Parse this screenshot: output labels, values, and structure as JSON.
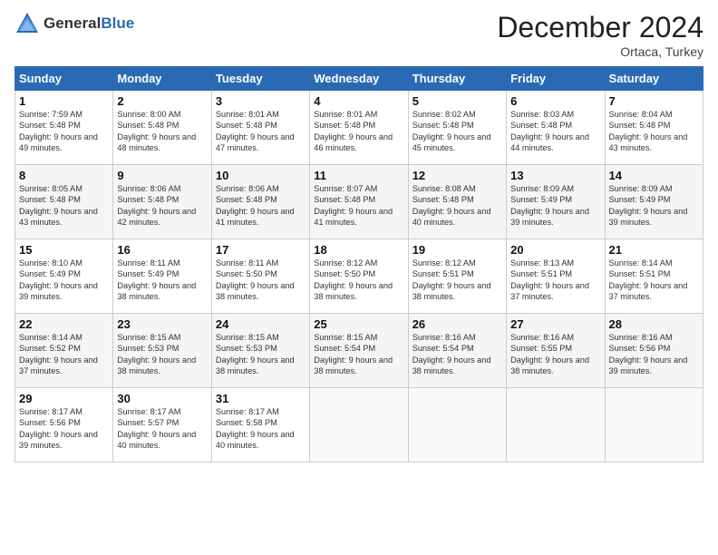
{
  "header": {
    "logo_general": "General",
    "logo_blue": "Blue",
    "month_title": "December 2024",
    "location": "Ortaca, Turkey"
  },
  "days_of_week": [
    "Sunday",
    "Monday",
    "Tuesday",
    "Wednesday",
    "Thursday",
    "Friday",
    "Saturday"
  ],
  "weeks": [
    [
      {
        "day": "1",
        "sunrise": "Sunrise: 7:59 AM",
        "sunset": "Sunset: 5:48 PM",
        "daylight": "Daylight: 9 hours and 49 minutes."
      },
      {
        "day": "2",
        "sunrise": "Sunrise: 8:00 AM",
        "sunset": "Sunset: 5:48 PM",
        "daylight": "Daylight: 9 hours and 48 minutes."
      },
      {
        "day": "3",
        "sunrise": "Sunrise: 8:01 AM",
        "sunset": "Sunset: 5:48 PM",
        "daylight": "Daylight: 9 hours and 47 minutes."
      },
      {
        "day": "4",
        "sunrise": "Sunrise: 8:01 AM",
        "sunset": "Sunset: 5:48 PM",
        "daylight": "Daylight: 9 hours and 46 minutes."
      },
      {
        "day": "5",
        "sunrise": "Sunrise: 8:02 AM",
        "sunset": "Sunset: 5:48 PM",
        "daylight": "Daylight: 9 hours and 45 minutes."
      },
      {
        "day": "6",
        "sunrise": "Sunrise: 8:03 AM",
        "sunset": "Sunset: 5:48 PM",
        "daylight": "Daylight: 9 hours and 44 minutes."
      },
      {
        "day": "7",
        "sunrise": "Sunrise: 8:04 AM",
        "sunset": "Sunset: 5:48 PM",
        "daylight": "Daylight: 9 hours and 43 minutes."
      }
    ],
    [
      {
        "day": "8",
        "sunrise": "Sunrise: 8:05 AM",
        "sunset": "Sunset: 5:48 PM",
        "daylight": "Daylight: 9 hours and 43 minutes."
      },
      {
        "day": "9",
        "sunrise": "Sunrise: 8:06 AM",
        "sunset": "Sunset: 5:48 PM",
        "daylight": "Daylight: 9 hours and 42 minutes."
      },
      {
        "day": "10",
        "sunrise": "Sunrise: 8:06 AM",
        "sunset": "Sunset: 5:48 PM",
        "daylight": "Daylight: 9 hours and 41 minutes."
      },
      {
        "day": "11",
        "sunrise": "Sunrise: 8:07 AM",
        "sunset": "Sunset: 5:48 PM",
        "daylight": "Daylight: 9 hours and 41 minutes."
      },
      {
        "day": "12",
        "sunrise": "Sunrise: 8:08 AM",
        "sunset": "Sunset: 5:48 PM",
        "daylight": "Daylight: 9 hours and 40 minutes."
      },
      {
        "day": "13",
        "sunrise": "Sunrise: 8:09 AM",
        "sunset": "Sunset: 5:49 PM",
        "daylight": "Daylight: 9 hours and 39 minutes."
      },
      {
        "day": "14",
        "sunrise": "Sunrise: 8:09 AM",
        "sunset": "Sunset: 5:49 PM",
        "daylight": "Daylight: 9 hours and 39 minutes."
      }
    ],
    [
      {
        "day": "15",
        "sunrise": "Sunrise: 8:10 AM",
        "sunset": "Sunset: 5:49 PM",
        "daylight": "Daylight: 9 hours and 39 minutes."
      },
      {
        "day": "16",
        "sunrise": "Sunrise: 8:11 AM",
        "sunset": "Sunset: 5:49 PM",
        "daylight": "Daylight: 9 hours and 38 minutes."
      },
      {
        "day": "17",
        "sunrise": "Sunrise: 8:11 AM",
        "sunset": "Sunset: 5:50 PM",
        "daylight": "Daylight: 9 hours and 38 minutes."
      },
      {
        "day": "18",
        "sunrise": "Sunrise: 8:12 AM",
        "sunset": "Sunset: 5:50 PM",
        "daylight": "Daylight: 9 hours and 38 minutes."
      },
      {
        "day": "19",
        "sunrise": "Sunrise: 8:12 AM",
        "sunset": "Sunset: 5:51 PM",
        "daylight": "Daylight: 9 hours and 38 minutes."
      },
      {
        "day": "20",
        "sunrise": "Sunrise: 8:13 AM",
        "sunset": "Sunset: 5:51 PM",
        "daylight": "Daylight: 9 hours and 37 minutes."
      },
      {
        "day": "21",
        "sunrise": "Sunrise: 8:14 AM",
        "sunset": "Sunset: 5:51 PM",
        "daylight": "Daylight: 9 hours and 37 minutes."
      }
    ],
    [
      {
        "day": "22",
        "sunrise": "Sunrise: 8:14 AM",
        "sunset": "Sunset: 5:52 PM",
        "daylight": "Daylight: 9 hours and 37 minutes."
      },
      {
        "day": "23",
        "sunrise": "Sunrise: 8:15 AM",
        "sunset": "Sunset: 5:53 PM",
        "daylight": "Daylight: 9 hours and 38 minutes."
      },
      {
        "day": "24",
        "sunrise": "Sunrise: 8:15 AM",
        "sunset": "Sunset: 5:53 PM",
        "daylight": "Daylight: 9 hours and 38 minutes."
      },
      {
        "day": "25",
        "sunrise": "Sunrise: 8:15 AM",
        "sunset": "Sunset: 5:54 PM",
        "daylight": "Daylight: 9 hours and 38 minutes."
      },
      {
        "day": "26",
        "sunrise": "Sunrise: 8:16 AM",
        "sunset": "Sunset: 5:54 PM",
        "daylight": "Daylight: 9 hours and 38 minutes."
      },
      {
        "day": "27",
        "sunrise": "Sunrise: 8:16 AM",
        "sunset": "Sunset: 5:55 PM",
        "daylight": "Daylight: 9 hours and 38 minutes."
      },
      {
        "day": "28",
        "sunrise": "Sunrise: 8:16 AM",
        "sunset": "Sunset: 5:56 PM",
        "daylight": "Daylight: 9 hours and 39 minutes."
      }
    ],
    [
      {
        "day": "29",
        "sunrise": "Sunrise: 8:17 AM",
        "sunset": "Sunset: 5:56 PM",
        "daylight": "Daylight: 9 hours and 39 minutes."
      },
      {
        "day": "30",
        "sunrise": "Sunrise: 8:17 AM",
        "sunset": "Sunset: 5:57 PM",
        "daylight": "Daylight: 9 hours and 40 minutes."
      },
      {
        "day": "31",
        "sunrise": "Sunrise: 8:17 AM",
        "sunset": "Sunset: 5:58 PM",
        "daylight": "Daylight: 9 hours and 40 minutes."
      },
      null,
      null,
      null,
      null
    ]
  ]
}
